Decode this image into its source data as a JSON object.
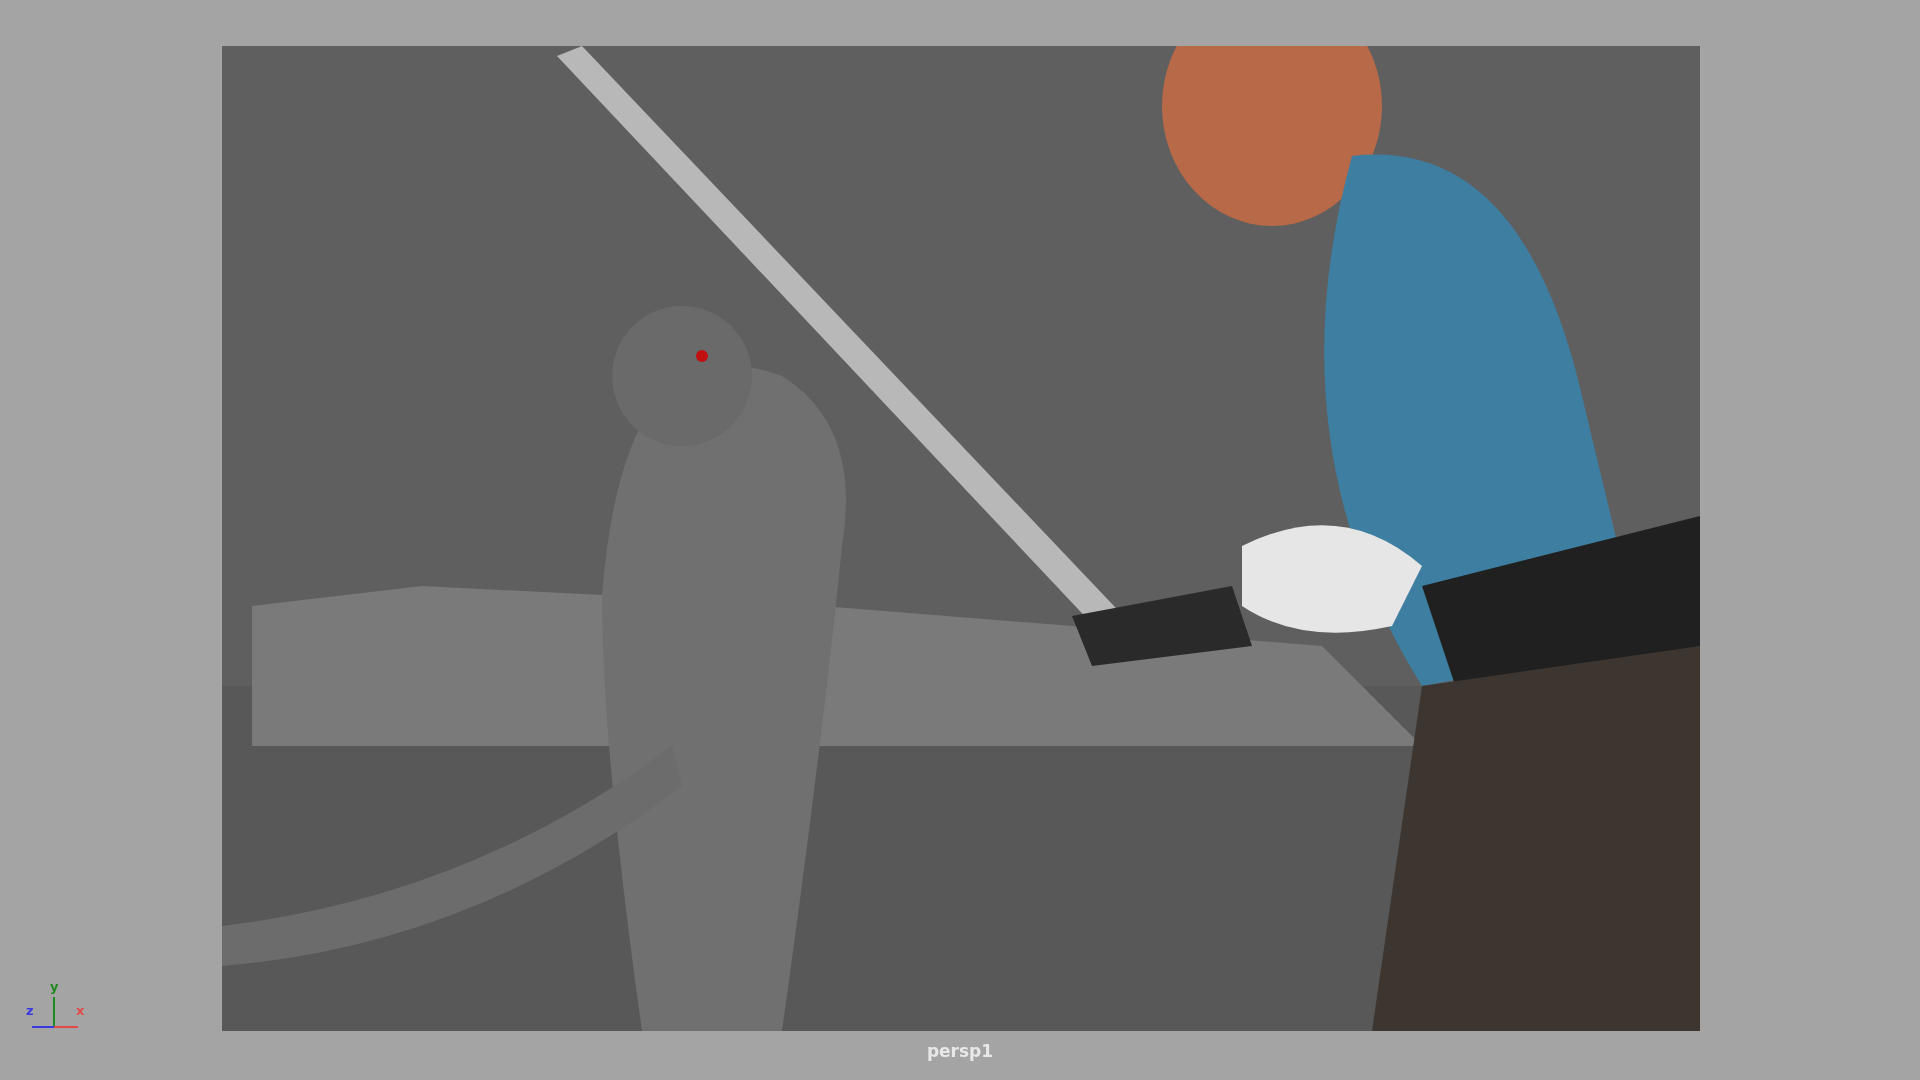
{
  "viewport": {
    "camera_label": "persp1",
    "axes": [
      {
        "label": "y",
        "color": "#1f8a1f"
      },
      {
        "label": "z",
        "color": "#3a3ae0"
      },
      {
        "label": "x",
        "color": "#e04a4a"
      }
    ]
  }
}
